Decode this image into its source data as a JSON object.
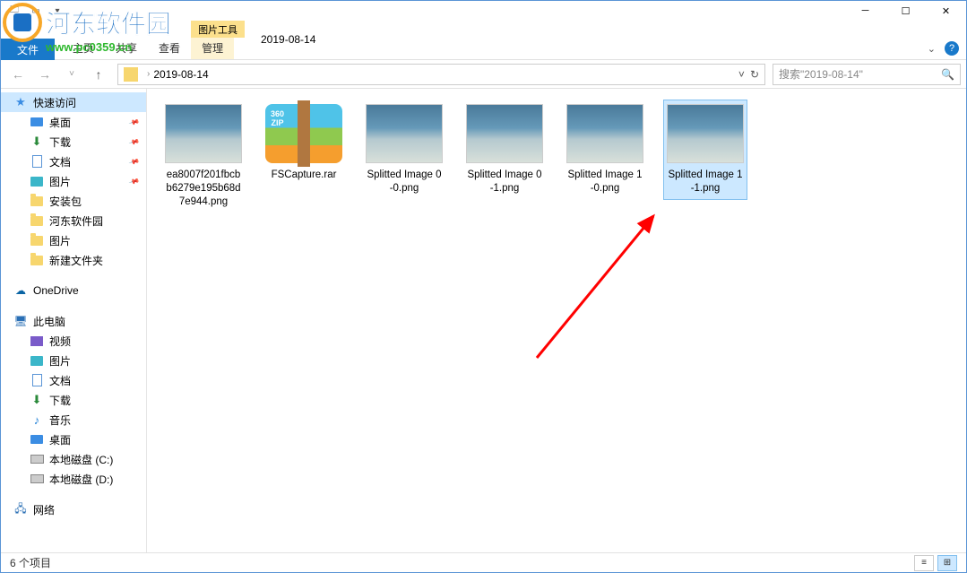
{
  "watermark": {
    "text": "河东软件园",
    "url": "www.pc0359.cn"
  },
  "titlebar": {
    "window_title": "2019-08-14"
  },
  "ribbon": {
    "file_tab": "文件",
    "context_group_label": "图片工具",
    "tabs": [
      "主页",
      "共享",
      "查看"
    ],
    "context_tab": "管理"
  },
  "toolbar": {
    "breadcrumb": [
      "2019-08-14"
    ],
    "search_placeholder": "搜索\"2019-08-14\""
  },
  "sidebar": {
    "quick_access": "快速访问",
    "quick_items": [
      {
        "label": "桌面",
        "icon": "desktop",
        "pinned": true
      },
      {
        "label": "下载",
        "icon": "download",
        "pinned": true
      },
      {
        "label": "文档",
        "icon": "doc",
        "pinned": true
      },
      {
        "label": "图片",
        "icon": "pic",
        "pinned": true
      },
      {
        "label": "安装包",
        "icon": "folder",
        "pinned": false
      },
      {
        "label": "河东软件园",
        "icon": "folder",
        "pinned": false
      },
      {
        "label": "图片",
        "icon": "folder",
        "pinned": false
      },
      {
        "label": "新建文件夹",
        "icon": "folder",
        "pinned": false
      }
    ],
    "onedrive": "OneDrive",
    "this_pc": "此电脑",
    "pc_items": [
      {
        "label": "视频",
        "icon": "video"
      },
      {
        "label": "图片",
        "icon": "pic"
      },
      {
        "label": "文档",
        "icon": "doc"
      },
      {
        "label": "下载",
        "icon": "download"
      },
      {
        "label": "音乐",
        "icon": "music"
      },
      {
        "label": "桌面",
        "icon": "desktop"
      },
      {
        "label": "本地磁盘 (C:)",
        "icon": "disk"
      },
      {
        "label": "本地磁盘 (D:)",
        "icon": "disk"
      }
    ],
    "network": "网络"
  },
  "files": [
    {
      "name": "ea8007f201fbcbb6279e195b68d7e944.png",
      "type": "img",
      "selected": false
    },
    {
      "name": "FSCapture.rar",
      "type": "rar",
      "selected": false
    },
    {
      "name": "Splitted Image 0-0.png",
      "type": "img",
      "selected": false
    },
    {
      "name": "Splitted Image 0-1.png",
      "type": "img",
      "selected": false
    },
    {
      "name": "Splitted Image 1-0.png",
      "type": "img",
      "selected": false
    },
    {
      "name": "Splitted Image 1-1.png",
      "type": "img",
      "selected": true
    }
  ],
  "statusbar": {
    "item_count": "6 个项目"
  }
}
